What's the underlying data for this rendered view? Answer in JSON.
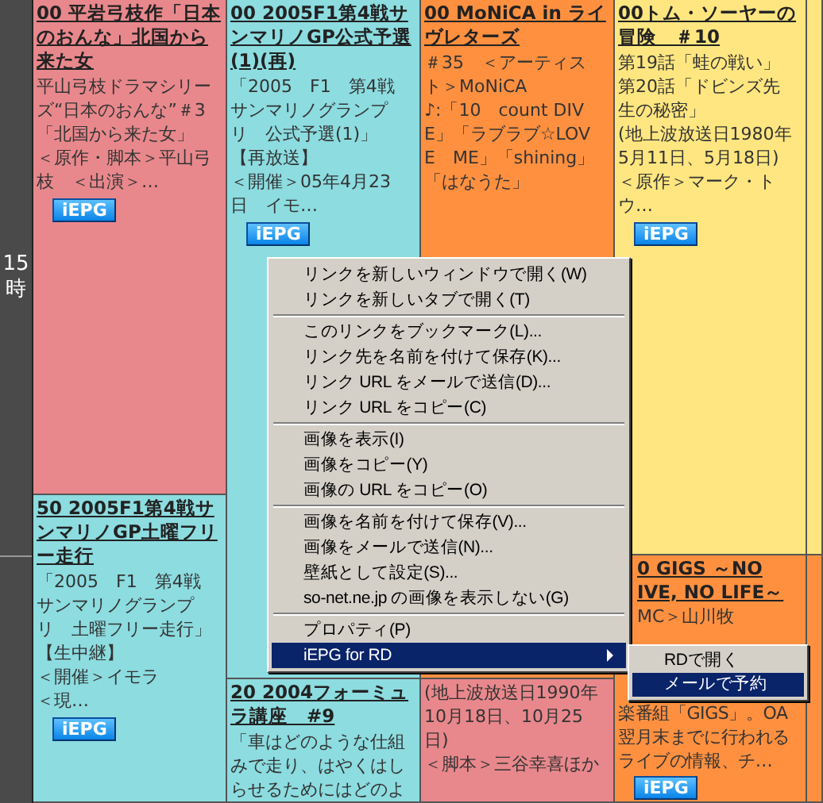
{
  "time_column": {
    "hour": "15\n時"
  },
  "columns": [
    {
      "programs": [
        {
          "color": "#e8888c",
          "title": "00 平岩弓枝作「日本のおんな」北国から来た女",
          "description": [
            "平山弓枝ドラマシリーズ“日本のおんな”＃3「北国から来た女」",
            "＜原作・脚本＞平山弓枝　＜出演＞…"
          ],
          "button": "iEPG"
        },
        {
          "color": "#8cdce0",
          "title": "50 2005F1第4戦サンマリノGP土曜フリー走行",
          "description": [
            "「2005　F1　第4戦サンマリノグランプリ　土曜フリー走行」",
            "【生中継】",
            "＜開催＞イモラ",
            "＜現…"
          ],
          "button": "iEPG"
        }
      ]
    },
    {
      "programs": [
        {
          "color": "#8cdce0",
          "title": "00 2005F1第4戦サンマリノGP公式予選(1)(再)",
          "description": [
            "「2005　F1　第4戦サンマリノグランプリ　公式予選(1)」【再放送】",
            "＜開催＞05年4月23日　イモ…"
          ],
          "button": "iEPG"
        },
        {
          "color": "#8cdce0",
          "title": "20 2004フォーミュラ講座　#9",
          "description": "「車はどのような仕組みで走り、はやくはしらせるためにはどのよ"
        }
      ]
    },
    {
      "programs": [
        {
          "color": "#ff9040",
          "title": "00 MoNiCA in ライヴレターズ",
          "description": [
            "＃35　＜アーティスト＞MoNiCA",
            "♪:「10　count DIVE」「ラブラブ☆LOVE　ME」「shining」「はなうた」"
          ]
        },
        {
          "color": "#e8888c",
          "description": [
            "(地上波放送日1990年10月18日、10月25日)",
            "＜脚本＞三谷幸喜ほか"
          ]
        }
      ]
    },
    {
      "programs": [
        {
          "color": "#ffe680",
          "title": "00トム・ソーヤーの冒険　＃10",
          "description": [
            "第19話「蛙の戦い」",
            "第20話「ドビンズ先生の秘密」",
            "(地上波放送日1980年5月11日、5月18日)＜原作＞マーク・トウ…"
          ],
          "button": "iEPG"
        },
        {
          "color": "#ff9040",
          "title": "0 GIGS ～NO\nIVE, NO LIFE～",
          "description": [
            "MC＞山川牧",
            "楽番組「GIGS」。OA翌月末までに行われるライブの情報、チ…"
          ],
          "button": "iEPG"
        }
      ]
    },
    {
      "programs": [
        {
          "color": "#ffe680"
        },
        {
          "color": "#ff9040"
        }
      ]
    }
  ],
  "context_menu": {
    "items": [
      {
        "kind": "item",
        "label": "リンクを新しいウィンドウで開く(W)",
        "selected": false
      },
      {
        "kind": "item",
        "label": "リンクを新しいタブで開く(T)",
        "selected": false
      },
      {
        "kind": "separator"
      },
      {
        "kind": "item",
        "label": "このリンクをブックマーク(L)...",
        "selected": false
      },
      {
        "kind": "item",
        "label": "リンク先を名前を付けて保存(K)...",
        "selected": false
      },
      {
        "kind": "item",
        "label": "リンク URL をメールで送信(D)...",
        "selected": false
      },
      {
        "kind": "item",
        "label": "リンク URL をコピー(C)",
        "selected": false
      },
      {
        "kind": "separator"
      },
      {
        "kind": "item",
        "label": "画像を表示(I)",
        "selected": false
      },
      {
        "kind": "item",
        "label": "画像をコピー(Y)",
        "selected": false
      },
      {
        "kind": "item",
        "label": "画像の URL をコピー(O)",
        "selected": false
      },
      {
        "kind": "separator"
      },
      {
        "kind": "item",
        "label": "画像を名前を付けて保存(V)...",
        "selected": false
      },
      {
        "kind": "item",
        "label": "画像をメールで送信(N)...",
        "selected": false
      },
      {
        "kind": "item",
        "label": "壁紙として設定(S)...",
        "selected": false
      },
      {
        "kind": "item",
        "label": "so-net.ne.jp の画像を表示しない(G)",
        "selected": false
      },
      {
        "kind": "separator"
      },
      {
        "kind": "item",
        "label": "プロパティ(P)",
        "selected": false
      },
      {
        "kind": "submenu",
        "label": "iEPG for RD",
        "selected": true
      }
    ]
  },
  "submenu": {
    "items": [
      {
        "kind": "item",
        "label": "RDで開く",
        "selected": false
      },
      {
        "kind": "item",
        "label": "メールで予約",
        "selected": true
      }
    ]
  }
}
